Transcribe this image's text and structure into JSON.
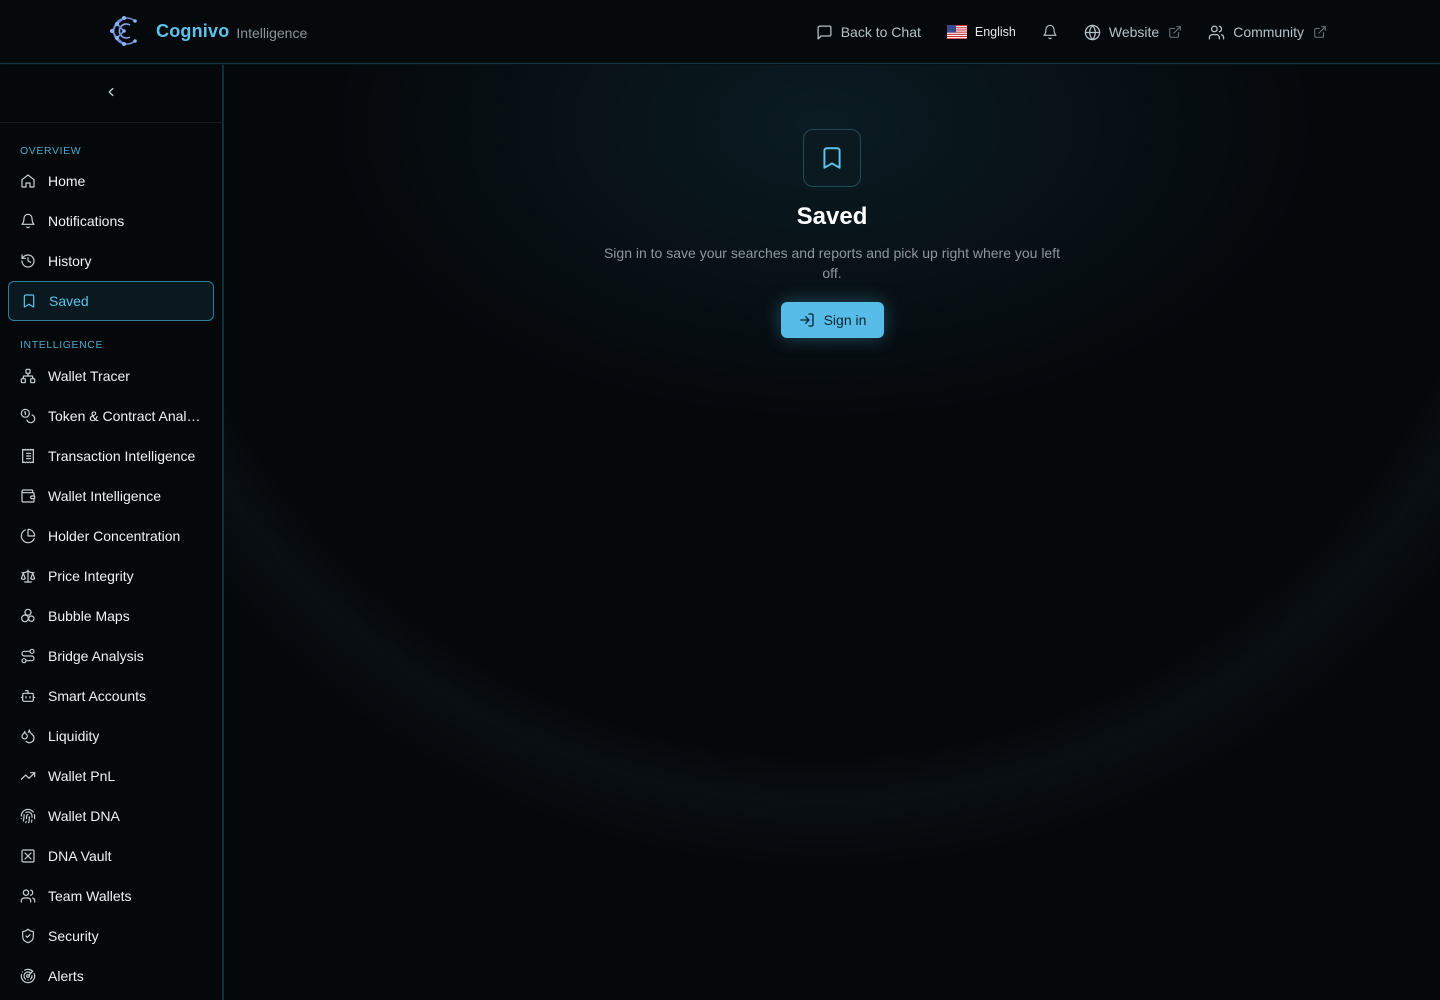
{
  "brand": {
    "name": "Cognivo",
    "sub": "Intelligence"
  },
  "topnav": {
    "back_to_chat": "Back to Chat",
    "language": "English",
    "website": "Website",
    "community": "Community"
  },
  "sidebar": {
    "overview_label": "OVERVIEW",
    "overview_items": [
      {
        "label": "Home",
        "icon": "home-icon"
      },
      {
        "label": "Notifications",
        "icon": "bell-icon"
      },
      {
        "label": "History",
        "icon": "history-icon"
      },
      {
        "label": "Saved",
        "icon": "bookmark-icon",
        "active": true
      }
    ],
    "intelligence_label": "INTELLIGENCE",
    "intelligence_items": [
      {
        "label": "Wallet Tracer",
        "icon": "network-icon"
      },
      {
        "label": "Token & Contract Analysis",
        "icon": "coins-icon"
      },
      {
        "label": "Transaction Intelligence",
        "icon": "receipt-icon"
      },
      {
        "label": "Wallet Intelligence",
        "icon": "wallet-icon"
      },
      {
        "label": "Holder Concentration",
        "icon": "pie-chart-icon"
      },
      {
        "label": "Price Integrity",
        "icon": "scale-icon"
      },
      {
        "label": "Bubble Maps",
        "icon": "bubbles-icon"
      },
      {
        "label": "Bridge Analysis",
        "icon": "route-icon"
      },
      {
        "label": "Smart Accounts",
        "icon": "bot-icon"
      },
      {
        "label": "Liquidity",
        "icon": "droplets-icon"
      },
      {
        "label": "Wallet PnL",
        "icon": "trending-up-icon"
      },
      {
        "label": "Wallet DNA",
        "icon": "fingerprint-icon"
      },
      {
        "label": "DNA Vault",
        "icon": "vault-icon"
      },
      {
        "label": "Team Wallets",
        "icon": "users-icon"
      },
      {
        "label": "Security",
        "icon": "shield-icon"
      },
      {
        "label": "Alerts",
        "icon": "radar-icon"
      }
    ]
  },
  "main": {
    "title": "Saved",
    "description": "Sign in to save your searches and reports and pick up right where you left off.",
    "signin_label": "Sign in"
  },
  "colors": {
    "accent": "#5cc4ec",
    "button": "#57bde8",
    "background": "#05080b",
    "border": "#0f3a45"
  }
}
